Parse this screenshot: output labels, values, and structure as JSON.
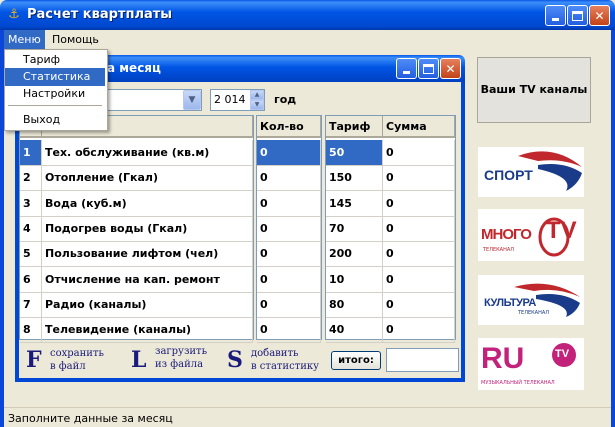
{
  "window": {
    "title": "Расчет квартплаты"
  },
  "menubar": {
    "menu": "Меню",
    "help": "Помощь"
  },
  "dropdown": {
    "items": [
      "Тариф",
      "Статистика",
      "Настройки",
      "Выход"
    ],
    "highlighted": "Статистика"
  },
  "child": {
    "title_visible": "за месяц"
  },
  "filters": {
    "month_value": "",
    "year_value": "2 014",
    "year_label": "год"
  },
  "grid_main": {
    "headers": [
      "",
      "ги"
    ],
    "rows": [
      [
        "1",
        "Тех. обслуживание (кв.м)"
      ],
      [
        "2",
        "Отопление (Гкал)"
      ],
      [
        "3",
        "Вода (куб.м)"
      ],
      [
        "4",
        "Подогрев воды (Гкал)"
      ],
      [
        "5",
        "Пользование лифтом (чел)"
      ],
      [
        "6",
        "Отчисление на кап. ремонт"
      ],
      [
        "7",
        "Радио (каналы)"
      ],
      [
        "8",
        "Телевидение (каналы)"
      ]
    ]
  },
  "grid_qty": {
    "header": "Кол-во",
    "values": [
      "0",
      "0",
      "0",
      "0",
      "0",
      "0",
      "0",
      "0"
    ]
  },
  "grid_rate": {
    "headers": [
      "Тариф",
      "Сумма"
    ],
    "rows": [
      [
        "50",
        "0"
      ],
      [
        "150",
        "0"
      ],
      [
        "145",
        "0"
      ],
      [
        "70",
        "0"
      ],
      [
        "200",
        "0"
      ],
      [
        "10",
        "0"
      ],
      [
        "80",
        "0"
      ],
      [
        "40",
        "0"
      ]
    ]
  },
  "shortcuts": [
    {
      "key": "F",
      "line1": "сохранить",
      "line2": "в файл"
    },
    {
      "key": "L",
      "line1": "загрузить",
      "line2": "из файла"
    },
    {
      "key": "S",
      "line1": "добавить",
      "line2": "в статистику"
    }
  ],
  "total": {
    "label": "итого:",
    "value": ""
  },
  "right_panel": {
    "tv_button": "Ваши TV  каналы",
    "logos": [
      {
        "name": "sport-logo",
        "text": "СПОРТ",
        "color": "#1a3a8a"
      },
      {
        "name": "mnogo-tv-logo",
        "text": "МНОГО",
        "text2": "TV",
        "sub": "ТЕЛЕКАНАЛ",
        "color": "#c0282d"
      },
      {
        "name": "kultura-logo",
        "text": "КУЛЬТУРА",
        "sub": "ТЕЛЕКАНАЛ",
        "color": "#1a3a8a"
      },
      {
        "name": "ru-tv-logo",
        "text": "RU",
        "text2": "TV",
        "sub": "МУЗЫКАЛЬНЫЙ ТЕЛЕКАНАЛ",
        "color": "#c2227a"
      }
    ]
  },
  "status": {
    "text": "Заполните данные за месяц"
  },
  "colors": {
    "titlebar": "#0055e5",
    "selection": "#316ac5",
    "window_bg": "#ece9d8"
  },
  "icons": {
    "app": "lamp-icon",
    "minimize": "minimize-icon",
    "maximize": "maximize-icon",
    "close": "close-icon"
  }
}
